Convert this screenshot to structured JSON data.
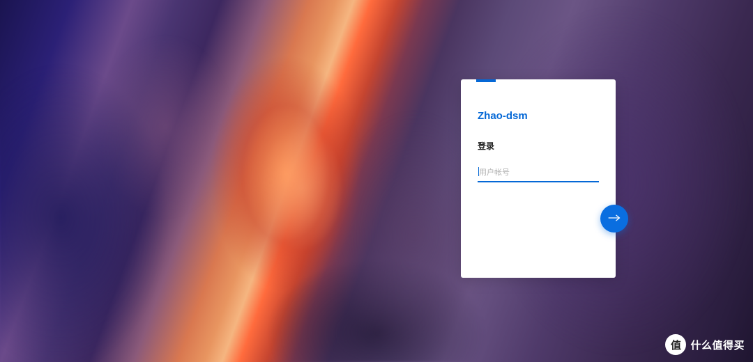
{
  "login": {
    "server_name": "Zhao-dsm",
    "title": "登录",
    "username_placeholder": "用户帐号",
    "username_value": ""
  },
  "watermark": {
    "badge_char": "值",
    "text": "什么值得买"
  },
  "colors": {
    "accent": "#0568d6",
    "button": "#0a6ee0"
  }
}
